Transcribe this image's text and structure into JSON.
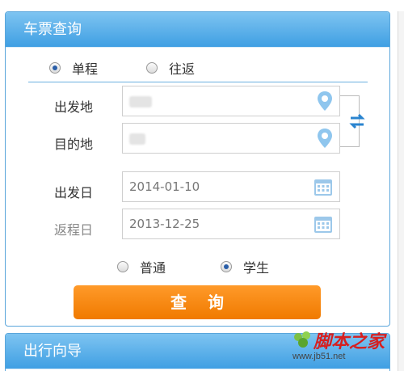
{
  "ticket_panel": {
    "title": "车票查询",
    "trip_type": [
      {
        "label": "单程",
        "selected": true
      },
      {
        "label": "往返",
        "selected": false
      }
    ],
    "fields": {
      "from_label": "出发地",
      "to_label": "目的地",
      "depart_date_label": "出发日",
      "return_date_label": "返程日",
      "from_value": "",
      "to_value": "",
      "depart_date": "2014-01-10",
      "return_date": "2013-12-25"
    },
    "passenger_type": [
      {
        "label": "普通",
        "selected": false
      },
      {
        "label": "学生",
        "selected": true
      }
    ],
    "search_label": "查询"
  },
  "guide_panel": {
    "title": "出行向导"
  },
  "watermark": {
    "site": "脚本之家",
    "url": "www.jb51.net"
  },
  "colors": {
    "header_blue": "#3f9fe3",
    "search_orange": "#f07a00",
    "radio_selected": "#2a5ea8"
  },
  "icons": {
    "location": "location-pin-icon",
    "calendar": "calendar-icon",
    "swap": "swap-arrows-icon"
  }
}
